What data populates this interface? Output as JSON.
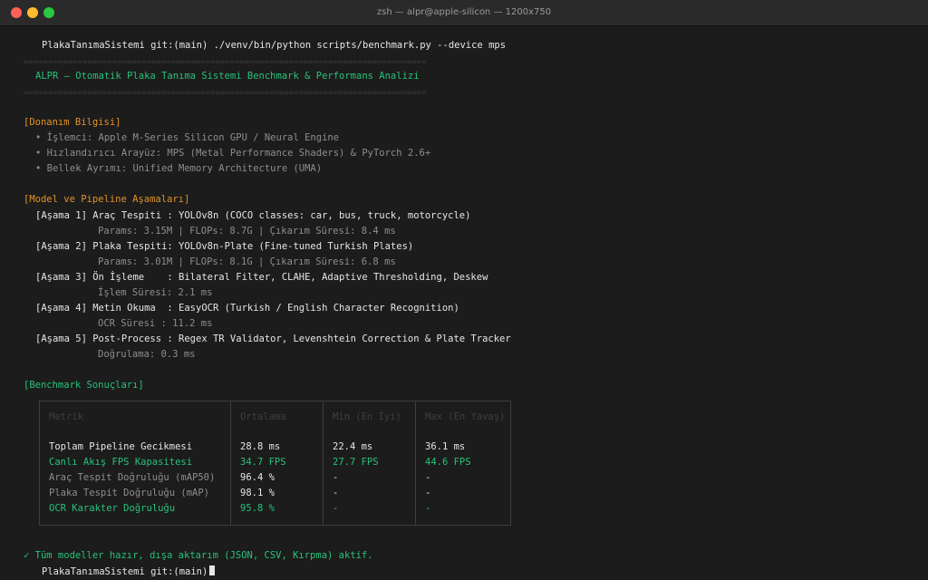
{
  "window": {
    "title": "zsh — alpr@apple-silicon — 1200x750"
  },
  "terminal": {
    "prompt_command": "PlakaTanımaSistemi git:(main) ./venv/bin/python scripts/benchmark.py --device mps",
    "separator": "==================================================================================",
    "banner": "ALPR — Otomatik Plaka Tanıma Sistemi Benchmark & Performans Analizi",
    "hardware": {
      "heading": "[Donanım Bilgisi]",
      "items": [
        "• İşlemci: Apple M-Series Silicon GPU / Neural Engine",
        "• Hızlandırıcı Arayüz: MPS (Metal Performance Shaders) & PyTorch 2.6+",
        "• Bellek Ayrımı: Unified Memory Architecture (UMA)"
      ]
    },
    "pipeline": {
      "heading": "[Model ve Pipeline Aşamaları]",
      "stages": [
        {
          "label": "[Aşama 1] Araç Tespiti : YOLOv8n (COCO classes: car, bus, truck, motorcycle)",
          "detail": "Params: 3.15M | FLOPs: 8.7G | Çıkarım Süresi: 8.4 ms"
        },
        {
          "label": "[Aşama 2] Plaka Tespiti: YOLOv8n-Plate (Fine-tuned Turkish Plates)",
          "detail": "Params: 3.01M | FLOPs: 8.1G | Çıkarım Süresi: 6.8 ms"
        },
        {
          "label": "[Aşama 3] Ön İşleme    : Bilateral Filter, CLAHE, Adaptive Thresholding, Deskew",
          "detail": "İşlem Süresi: 2.1 ms"
        },
        {
          "label": "[Aşama 4] Metin Okuma  : EasyOCR (Turkish / English Character Recognition)",
          "detail": "OCR Süresi : 11.2 ms"
        },
        {
          "label": "[Aşama 5] Post-Process : Regex TR Validator, Levenshtein Correction & Plate Tracker",
          "detail": "Doğrulama: 0.3 ms"
        }
      ]
    },
    "benchmark": {
      "heading": "[Benchmark Sonuçları]",
      "columns": [
        "Metrik",
        "Ortalama",
        "Min (En İyi)",
        "Max (En Yavaş)"
      ],
      "rows": [
        {
          "metric": "Toplam Pipeline Gecikmesi",
          "avg": "28.8 ms",
          "min": "22.4 ms",
          "max": "36.1 ms",
          "highlight": false
        },
        {
          "metric": "Canlı Akış FPS Kapasitesi",
          "avg": "34.7 FPS",
          "min": "27.7 FPS",
          "max": "44.6 FPS",
          "highlight": true
        },
        {
          "metric": "Araç Tespit Doğruluğu (mAP50)",
          "avg": "96.4 %",
          "min": "-",
          "max": "-",
          "highlight": false
        },
        {
          "metric": "Plaka Tespit Doğruluğu (mAP)",
          "avg": "98.1 %",
          "min": "-",
          "max": "-",
          "highlight": false
        },
        {
          "metric": "OCR Karakter Doğruluğu",
          "avg": "95.8 %",
          "min": "-",
          "max": "-",
          "highlight": true
        }
      ]
    },
    "status": "✓ Tüm modeller hazır, dışa aktarım (JSON, CSV, Kırpma) aktif.",
    "final_prompt": "PlakaTanımaSistemi git:(main)"
  },
  "colors": {
    "background": "#1c1c1c",
    "text": "#e6e6e6",
    "muted": "#8e8e8e",
    "accent_green": "#27c27a",
    "heading_orange": "#e0922a"
  }
}
